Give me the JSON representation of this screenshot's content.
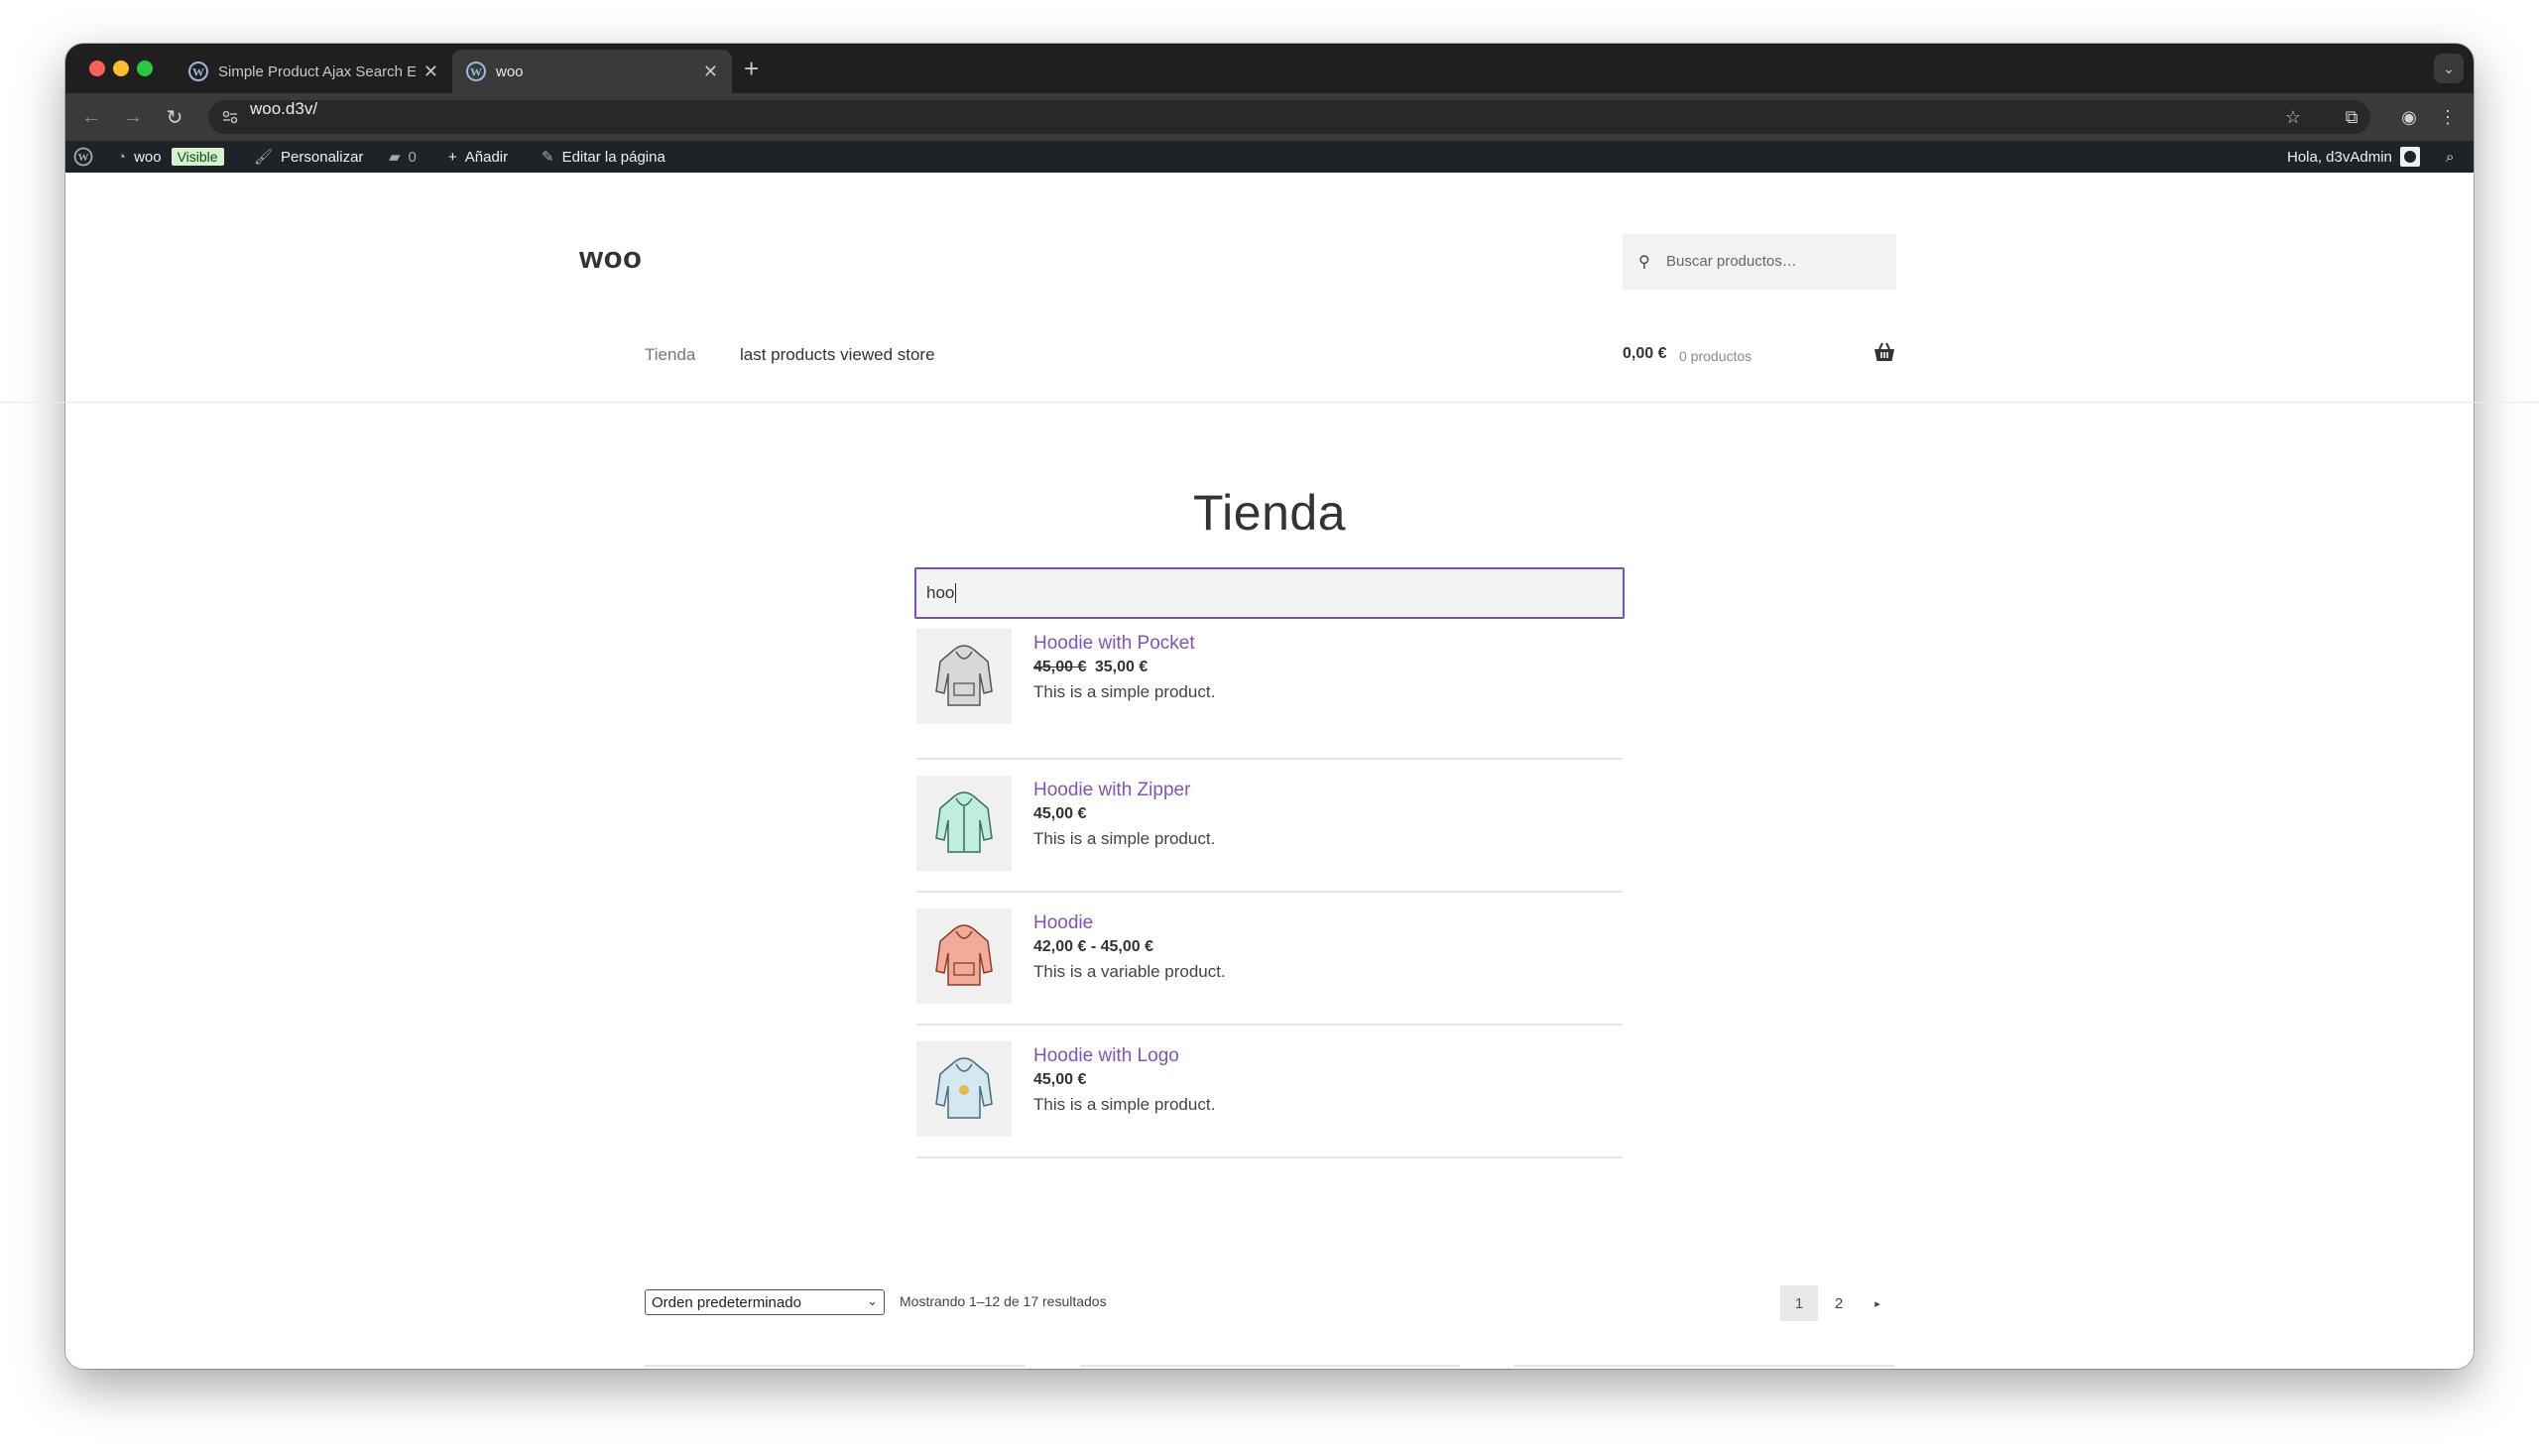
{
  "browser": {
    "tabs": [
      {
        "title": "Simple Product Ajax Search E",
        "active": false
      },
      {
        "title": "woo",
        "active": true
      }
    ],
    "new_tab": "+",
    "url": "woo.d3v/"
  },
  "adminbar": {
    "site_name": "woo",
    "visible_badge": "Visible",
    "customize": "Personalizar",
    "comments_count": "0",
    "add_new": "Añadir",
    "edit_page": "Editar la página",
    "greeting": "Hola, d3vAdmin"
  },
  "site": {
    "title": "woo",
    "search_placeholder": "Buscar productos…",
    "nav": [
      "Tienda",
      "last products viewed store"
    ],
    "cart_amount": "0,00 €",
    "cart_count": "0 productos"
  },
  "main": {
    "page_title": "Tienda",
    "search_value": "hoo",
    "results": [
      {
        "name": "Hoodie with Pocket",
        "old_price": "45,00 €",
        "price": "35,00 €",
        "desc": "This is a simple product.",
        "color": "#a8a8a8"
      },
      {
        "name": "Hoodie with Zipper",
        "old_price": "",
        "price": "45,00 €",
        "desc": "This is a simple product.",
        "color": "#7fd6bc"
      },
      {
        "name": "Hoodie",
        "old_price": "",
        "price": "42,00 € - 45,00 €",
        "desc": "This is a variable product.",
        "color": "#ea8d78"
      },
      {
        "name": "Hoodie with Logo",
        "old_price": "",
        "price": "45,00 €",
        "desc": "This is a simple product.",
        "color": "#a6cfe0"
      }
    ],
    "sort_label": "Orden predeterminado",
    "result_count": "Mostrando 1–12 de 17 resultados",
    "pages": [
      "1",
      "2"
    ],
    "next_page": "▸"
  }
}
